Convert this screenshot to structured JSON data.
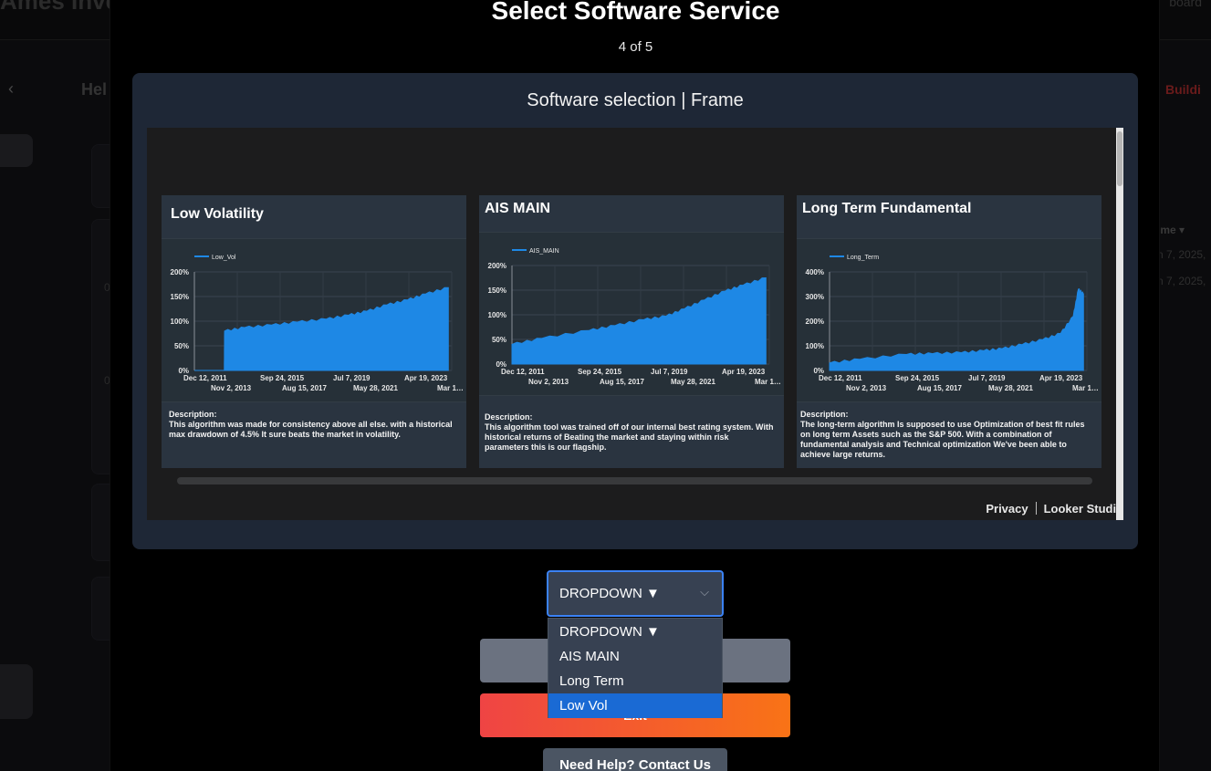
{
  "background": {
    "brand": "Ames Inve",
    "nav_right": "board",
    "back_icon": "chevron-left",
    "greeting": "Hel",
    "breadcrumb_prev": "s",
    "breadcrumb_current": "Buildi",
    "table_header": "ime ▾",
    "table_rows": [
      "n 7, 2025,",
      "n 7, 2025,"
    ],
    "zero_values": [
      "0",
      "0"
    ]
  },
  "modal": {
    "title": "Select Software Service",
    "step": "4 of 5",
    "frame_title": "Software selection | Frame",
    "footer_privacy": "Privacy",
    "footer_looker": "Looker Studio"
  },
  "cards": [
    {
      "title": "Low Volatility",
      "legend": "Low_Vol",
      "description_label": "Description:",
      "description": "This algorithm was made for consistency above all else. with a historical max drawdown of 4.5% It sure beats the market in volatility."
    },
    {
      "title": "AIS MAIN",
      "legend": "AIS_MAIN",
      "description_label": "Description:",
      "description": "This algorithm tool was trained off of our internal best rating system. With historical returns of Beating the market and staying within risk parameters this is our flagship."
    },
    {
      "title": "Long Term Fundamental",
      "legend": "Long_Term",
      "description_label": "Description:",
      "description": "The long-term algorithm Is supposed to use Optimization of best fit rules on long term Assets such as the S&P 500. With a combination of fundamental analysis and Technical optimization We've been able to achieve large returns."
    }
  ],
  "chart_data": [
    {
      "type": "area",
      "series": [
        {
          "name": "Low_Vol",
          "x": [
            "2011-12-12",
            "2013-06-01",
            "2013-06-05",
            "2014-06-01",
            "2015-09-24",
            "2017-01-01",
            "2018-06-01",
            "2019-07-07",
            "2020-06-01",
            "2021-05-28",
            "2022-06-01",
            "2023-04-19",
            "2024-06-01"
          ],
          "values": [
            0,
            0,
            80,
            87,
            92,
            98,
            104,
            112,
            120,
            133,
            143,
            155,
            168
          ]
        }
      ],
      "ylim": [
        0,
        200
      ],
      "yticks": [
        "200%",
        "150%",
        "100%",
        "50%",
        "0%"
      ],
      "xticks_top": [
        "Dec 12, 2011",
        "Sep 24, 2015",
        "Jul 7, 2019",
        "Apr 19, 2023"
      ],
      "xticks_bottom": [
        "Nov 2, 2013",
        "Aug 15, 2017",
        "May 28, 2021",
        "Mar 1…"
      ],
      "color": "#1e88e5"
    },
    {
      "type": "area",
      "series": [
        {
          "name": "AIS_MAIN",
          "x": [
            "2011-12-12",
            "2013-06-01",
            "2015-09-24",
            "2017-01-01",
            "2018-06-01",
            "2019-07-07",
            "2020-06-01",
            "2021-05-28",
            "2022-06-01",
            "2023-04-19",
            "2024-06-01"
          ],
          "values": [
            40,
            52,
            68,
            78,
            90,
            97,
            112,
            130,
            148,
            160,
            175
          ]
        }
      ],
      "ylim": [
        0,
        200
      ],
      "yticks": [
        "200%",
        "150%",
        "100%",
        "50%",
        "0%"
      ],
      "xticks_top": [
        "Dec 12, 2011",
        "Sep 24, 2015",
        "Jul 7, 2019",
        "Apr 19, 2023"
      ],
      "xticks_bottom": [
        "Nov 2, 2013",
        "Aug 15, 2017",
        "May 28, 2021",
        "Mar 1…"
      ],
      "color": "#1e88e5"
    },
    {
      "type": "area",
      "series": [
        {
          "name": "Long_Term",
          "x": [
            "2011-12-12",
            "2013-06-01",
            "2015-09-24",
            "2017-01-01",
            "2018-06-01",
            "2019-07-07",
            "2020-06-01",
            "2021-05-28",
            "2022-06-01",
            "2023-04-19",
            "2023-12-01",
            "2024-03-01",
            "2024-06-01"
          ],
          "values": [
            30,
            45,
            65,
            68,
            72,
            80,
            88,
            105,
            125,
            150,
            220,
            330,
            310
          ]
        }
      ],
      "ylim": [
        0,
        400
      ],
      "yticks": [
        "400%",
        "300%",
        "200%",
        "100%",
        "0%"
      ],
      "xticks_top": [
        "Dec 12, 2011",
        "Sep 24, 2015",
        "Jul 7, 2019",
        "Apr 19, 2023"
      ],
      "xticks_bottom": [
        "Nov 2, 2013",
        "Aug 15, 2017",
        "May 28, 2021",
        "Mar 1…"
      ],
      "color": "#1e88e5"
    }
  ],
  "dropdown": {
    "selected_label": "DROPDOWN ▼",
    "chevron_icon": "chevron-down",
    "options": [
      "DROPDOWN ▼",
      "AIS MAIN",
      "Long Term",
      "Low Vol"
    ],
    "highlighted": "Low Vol"
  },
  "buttons": {
    "exit": "Exit",
    "help": "Need Help? Contact Us"
  },
  "colors": {
    "modal_card": "#1e2736",
    "accent": "#3b82f6",
    "highlight": "#1a6ad4",
    "chart_fill": "#1e88e5",
    "exit_gradient_start": "#ef4444",
    "exit_gradient_end": "#f97316"
  }
}
